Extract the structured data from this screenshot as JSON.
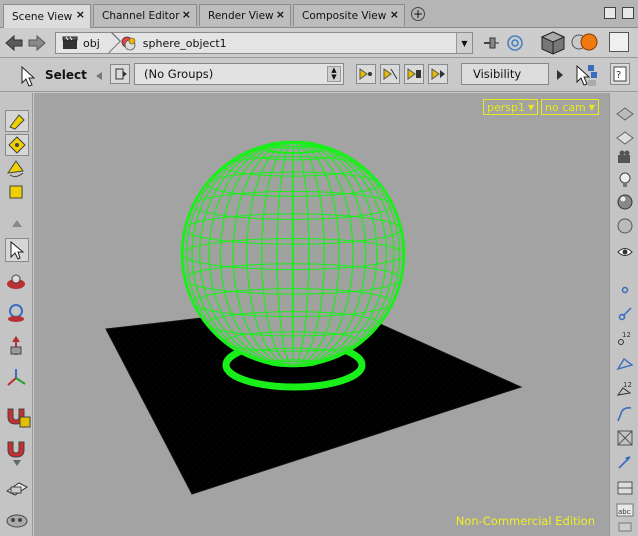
{
  "tabs": [
    {
      "label": "Scene View",
      "active": true
    },
    {
      "label": "Channel Editor",
      "active": false
    },
    {
      "label": "Render View",
      "active": false
    },
    {
      "label": "Composite View",
      "active": false
    }
  ],
  "path": {
    "root": "obj",
    "object": "sphere_object1"
  },
  "selbar": {
    "select_label": "Select",
    "groups_value": "(No Groups)",
    "visibility_label": "Visibility"
  },
  "viewport": {
    "camera": "persp1",
    "cam_menu": "no cam",
    "watermark": "Non-Commercial Edition"
  },
  "colors": {
    "background": "#a3a3a3",
    "wireframe": "#19f019",
    "ground": "#000000",
    "overlay_text": "#efef23"
  },
  "icons": {
    "back": "arrow-left-icon",
    "forward": "arrow-right-icon",
    "obj": "clapperboard-icon",
    "object": "geometry-object-icon",
    "pin": "pin-icon",
    "link": "link-icon",
    "cube": "cube-icon",
    "render": "render-sphere-icon",
    "window": "window-icon"
  }
}
